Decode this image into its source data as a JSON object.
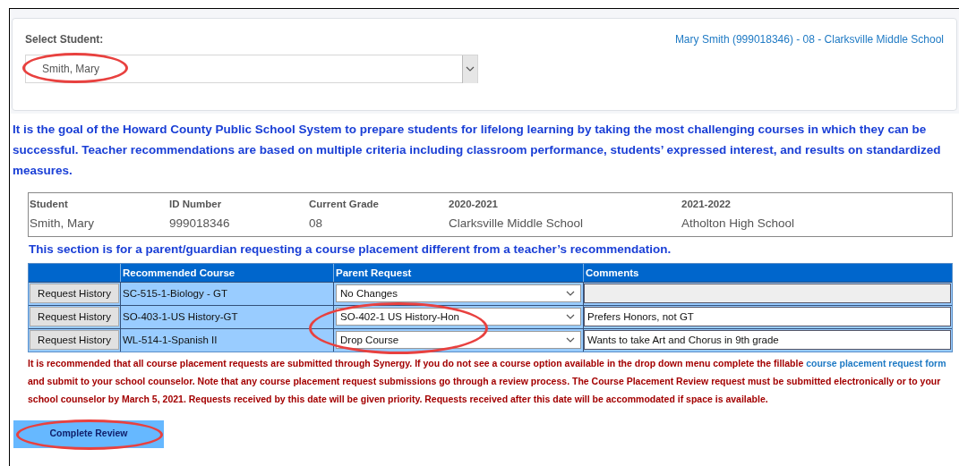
{
  "student_select": {
    "label": "Select Student:",
    "value": "Smith, Mary"
  },
  "student_summary": "Mary Smith (999018346) - 08 - Clarksville Middle School",
  "intro": "It is the goal of the Howard County Public School System to prepare students for lifelong learning by taking the most challenging courses in which they can be successful. Teacher recommendations are based on multiple criteria including classroom performance, students’ expressed interest, and results on standardized measures.",
  "info_table": {
    "columns": [
      "Student",
      "ID Number",
      "Current Grade",
      "2020-2021",
      "2021-2022"
    ],
    "values": [
      "Smith, Mary",
      "999018346",
      "08",
      "Clarksville Middle School",
      "Atholton High School"
    ]
  },
  "section_note": "This section is for a parent/guardian requesting a course placement different from a teacher’s recommendation.",
  "course_table": {
    "columns": [
      "Recommended Course",
      "Parent Request",
      "Comments"
    ],
    "rows": [
      {
        "button": "Request History",
        "recommended": "SC-515-1-Biology - GT",
        "request": "No Changes",
        "comment_disabled": true
      },
      {
        "button": "Request History",
        "recommended": "SO-403-1-US History-GT",
        "request": "SO-402-1 US History-Hon",
        "comment": "Prefers Honors, not GT",
        "comment_disabled": false
      },
      {
        "button": "Request History",
        "recommended": "WL-514-1-Spanish II",
        "request": "Drop Course",
        "comment": "Wants to take Art and Chorus in 9th grade",
        "comment_disabled": false
      }
    ]
  },
  "disclaimer": {
    "before": "It is recommended that all course placement requests are submitted through Synergy. If you do not see a course option available in the drop down menu complete the fillable",
    "link": "course placement request form",
    "after": "and submit to your school counselor. Note that any course placement request submissions go through a review process. The Course Placement Review request must be submitted electronically or to your school counselor by March 5, 2021. Requests received by this date will be given priority. Requests received after this date will be accommodated if space is available."
  },
  "complete_button": "Complete Review"
}
